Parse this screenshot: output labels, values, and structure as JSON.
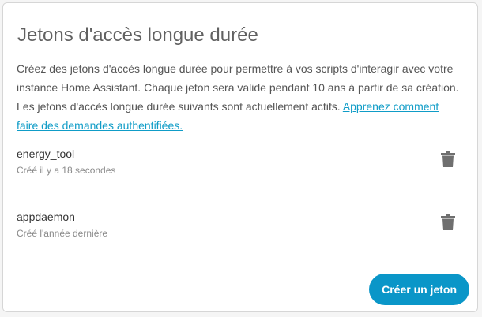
{
  "card": {
    "title": "Jetons d'accès longue durée",
    "description_text": "Créez des jetons d'accès longue durée pour permettre à vos scripts d'interagir avec votre instance Home Assistant. Chaque jeton sera valide pendant 10 ans à partir de sa création. Les jetons d'accès longue durée suivants sont actuellement actifs. ",
    "learn_more_link": "Apprenez comment faire des demandes authentifiées."
  },
  "tokens": [
    {
      "name": "energy_tool",
      "created": "Créé il y a 18 secondes",
      "delete_icon": "trash-icon"
    },
    {
      "name": "appdaemon",
      "created": "Créé l'année dernière",
      "delete_icon": "trash-icon"
    }
  ],
  "actions": {
    "create_label": "Créer un jeton"
  },
  "colors": {
    "accent": "#0a96c8",
    "link": "#0f9cc7",
    "icon": "#6f6f6f"
  }
}
